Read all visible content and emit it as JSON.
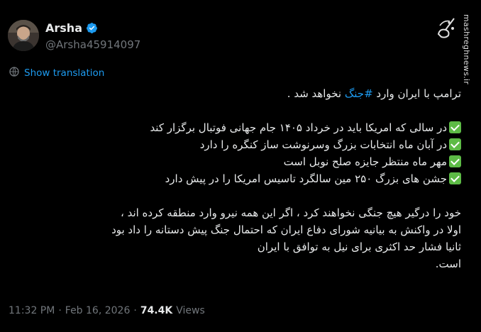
{
  "author": {
    "name": "Arsha",
    "handle": "@Arsha45914097"
  },
  "translate_label": "Show translation",
  "tweet": {
    "line1_pre": "ترامپ با ایران وارد ",
    "line1_hashtag": "#جنگ",
    "line1_post": " نخواهد شد .",
    "checklist": [
      "در سالی که امریکا باید در خرداد ۱۴۰۵ جام جهانی فوتبال برگزار کند",
      "در آبان ماه انتخابات بزرگ وسرنوشت ساز کنگره را دارد",
      "مهر ماه منتظر جایزه صلح نوبل است",
      "جشن های بزرگ ۲۵۰ مین سالگرد تاسیس امریکا را در پیش دارد"
    ],
    "paragraph": [
      "خود را درگیر هیچ جنگی نخواهند کرد ، اگر این همه نیرو وارد منطقه کرده اند ،",
      "اولا در واکنش به بیانیه شورای دفاع ایران که احتمال جنگ پیش دستانه را داد بود",
      "ثانیا فشار حد اکثری برای نیل به توافق با ایران",
      "است."
    ]
  },
  "meta": {
    "time": "11:32 PM",
    "separator": "·",
    "date": "Feb 16, 2026",
    "views_count": "74.4K",
    "views_label": "Views"
  },
  "watermark": {
    "site": "mashreghnews.ir",
    "logo_text": "مشرق"
  },
  "colors": {
    "background": "#000000",
    "text": "#e7e9ea",
    "muted": "#71767b",
    "accent": "#1d9bf0",
    "check": "#5dbb46"
  }
}
